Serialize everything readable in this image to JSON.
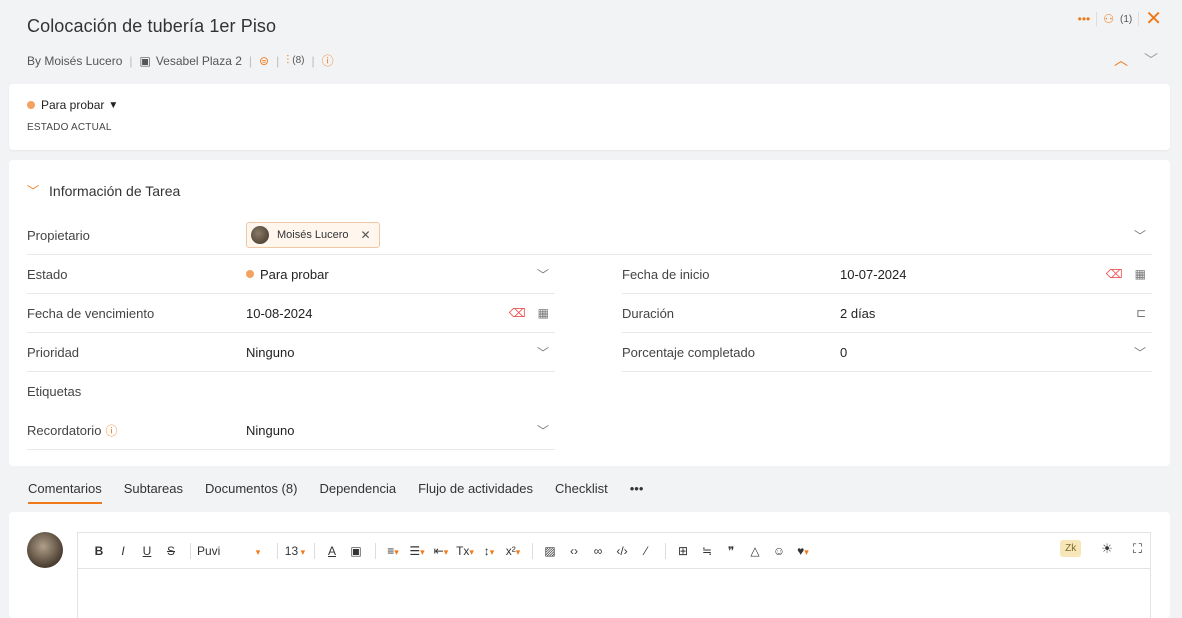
{
  "task": {
    "title": "Colocación de tubería 1er Piso",
    "by": "By Moisés Lucero",
    "project": "Vesabel Plaza 2",
    "attachments_count": "(8)"
  },
  "top_actions": {
    "subtasks_count": "(1)"
  },
  "status": {
    "value": "Para probar",
    "label": "ESTADO ACTUAL",
    "dot_color": "#f4a261"
  },
  "info": {
    "section_title": "Información de Tarea",
    "fields": {
      "owner_label": "Propietario",
      "owner_value": "Moisés Lucero",
      "estado_label": "Estado",
      "estado_value": "Para probar",
      "due_label": "Fecha de vencimiento",
      "due_value": "10-08-2024",
      "priority_label": "Prioridad",
      "priority_value": "Ninguno",
      "tags_label": "Etiquetas",
      "reminder_label": "Recordatorio",
      "reminder_value": "Ninguno",
      "start_label": "Fecha de inicio",
      "start_value": "10-07-2024",
      "duration_label": "Duración",
      "duration_value": "2 días",
      "percent_label": "Porcentaje completado",
      "percent_value": "0"
    }
  },
  "tabs": [
    {
      "label": "Comentarios"
    },
    {
      "label": "Subtareas"
    },
    {
      "label": "Documentos (8)"
    },
    {
      "label": "Dependencia"
    },
    {
      "label": "Flujo de actividades"
    },
    {
      "label": "Checklist"
    },
    {
      "label": "•••"
    }
  ],
  "editor": {
    "font": "Puvi",
    "size": "13",
    "lang_badge": "Zk"
  },
  "colors": {
    "accent": "#f07a1a",
    "danger": "#e55"
  }
}
